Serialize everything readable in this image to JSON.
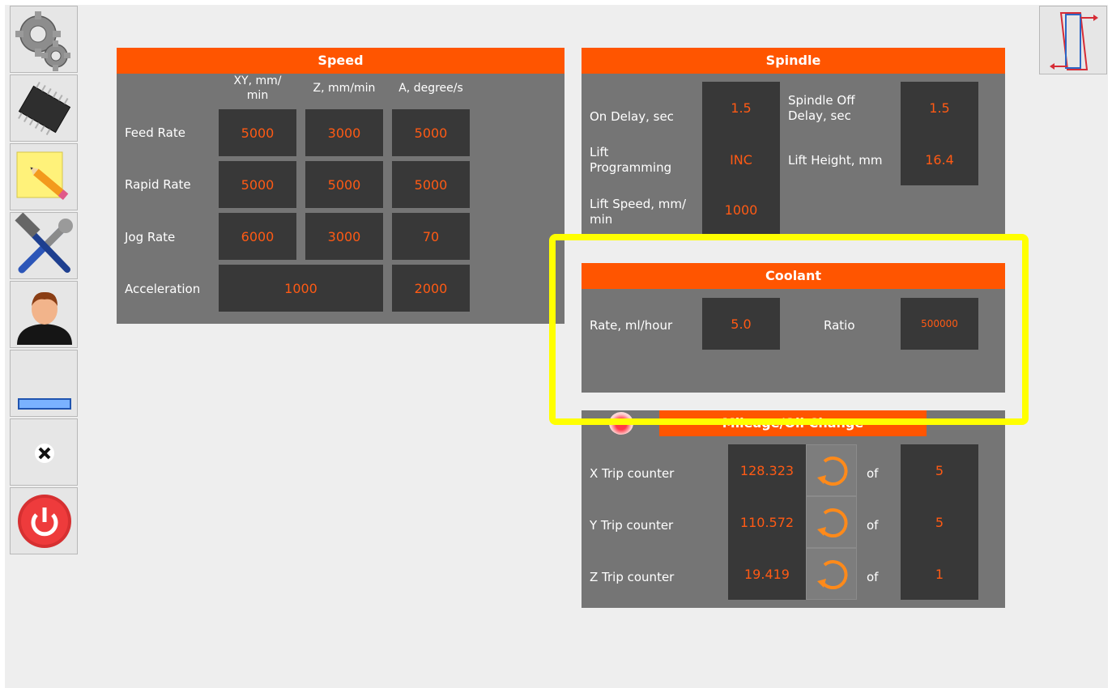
{
  "sidebar": {
    "items": [
      {
        "name": "settings-gears",
        "icon": "gears-icon"
      },
      {
        "name": "hardware-chip",
        "icon": "chip-icon"
      },
      {
        "name": "notes",
        "icon": "note-pencil-icon"
      },
      {
        "name": "tools",
        "icon": "wrench-hammer-icon"
      },
      {
        "name": "user",
        "icon": "user-icon"
      },
      {
        "name": "minimize",
        "icon": "minimize-icon"
      },
      {
        "name": "close",
        "icon": "close-icon"
      },
      {
        "name": "power",
        "icon": "power-icon"
      }
    ]
  },
  "top_right_button": {
    "icon": "mirror-flip-icon"
  },
  "speed": {
    "title": "Speed",
    "columns": [
      "XY, mm/\nmin",
      "Z, mm/min",
      "A, degree/s"
    ],
    "rows": [
      {
        "label": "Feed Rate",
        "xy": "5000",
        "z": "3000",
        "a": "5000"
      },
      {
        "label": "Rapid Rate",
        "xy": "5000",
        "z": "5000",
        "a": "5000"
      },
      {
        "label": "Jog Rate",
        "xy": "6000",
        "z": "3000",
        "a": "70"
      }
    ],
    "acceleration": {
      "label": "Acceleration",
      "xyz": "1000",
      "a": "2000"
    }
  },
  "spindle": {
    "title": "Spindle",
    "on_delay": {
      "label": "On Delay, sec",
      "value": "1.5"
    },
    "off_delay": {
      "label": "Spindle Off\nDelay, sec",
      "value": "1.5"
    },
    "lift_programming": {
      "label": "Lift\nProgramming",
      "value": "INC"
    },
    "lift_height": {
      "label": "Lift Height, mm",
      "value": "16.4"
    },
    "lift_speed": {
      "label": "Lift Speed, mm/\nmin",
      "value": "1000"
    }
  },
  "coolant": {
    "title": "Coolant",
    "rate": {
      "label": "Rate, ml/hour",
      "value": "5.0"
    },
    "ratio": {
      "label": "Ratio",
      "value": "500000"
    }
  },
  "mileage": {
    "title": "Mileage/Oil Change",
    "of_label": "of",
    "rows": [
      {
        "label": "X Trip counter",
        "value": "128.323",
        "limit": "5"
      },
      {
        "label": "Y Trip counter",
        "value": "110.572",
        "limit": "5"
      },
      {
        "label": "Z Trip counter",
        "value": "19.419",
        "limit": "1"
      }
    ]
  },
  "colors": {
    "accent": "#ff5500",
    "panel": "#757575",
    "value_bg": "#383838",
    "value_text": "#ff5a14",
    "highlight": "#ffff00"
  }
}
